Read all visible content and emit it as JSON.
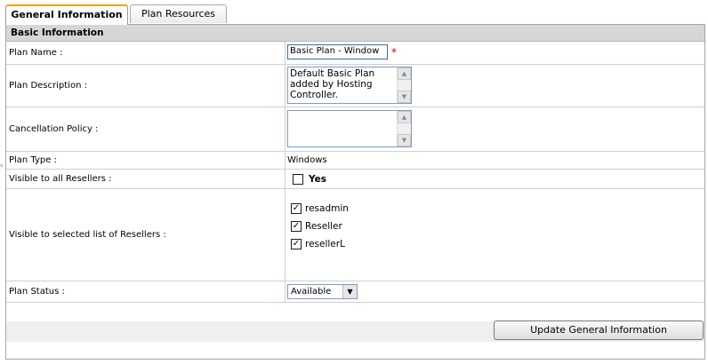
{
  "tabs": [
    {
      "label": "General Information",
      "active": true
    },
    {
      "label": "Plan Resources",
      "active": false
    }
  ],
  "section": {
    "title": "Basic Information"
  },
  "fields": {
    "plan_name": {
      "label": "Plan Name :",
      "value": "Basic Plan - Window",
      "required_mark": "*"
    },
    "plan_description": {
      "label": "Plan Description :",
      "value": "Default Basic Plan added by Hosting Controller."
    },
    "cancellation_policy": {
      "label": "Cancellation Policy :",
      "value": ""
    },
    "plan_type": {
      "label": "Plan Type :",
      "value": "Windows"
    },
    "visible_all": {
      "label": "Visible to all Resellers :",
      "option_label": "Yes",
      "checked": false
    },
    "visible_selected": {
      "label": "Visible to selected list of Resellers :",
      "resellers": [
        {
          "name": "resadmin",
          "checked": true
        },
        {
          "name": "Reseller",
          "checked": true
        },
        {
          "name": "resellerL",
          "checked": true
        }
      ]
    },
    "plan_status": {
      "label": "Plan Status :",
      "selected": "Available"
    }
  },
  "buttons": {
    "update": "Update General Information"
  },
  "colors": {
    "required": "#d40000",
    "active_tab_accent": "#f0a000"
  },
  "icons": {
    "checkmark": "checkmark-icon",
    "dropdown": "chevron-down-icon"
  }
}
